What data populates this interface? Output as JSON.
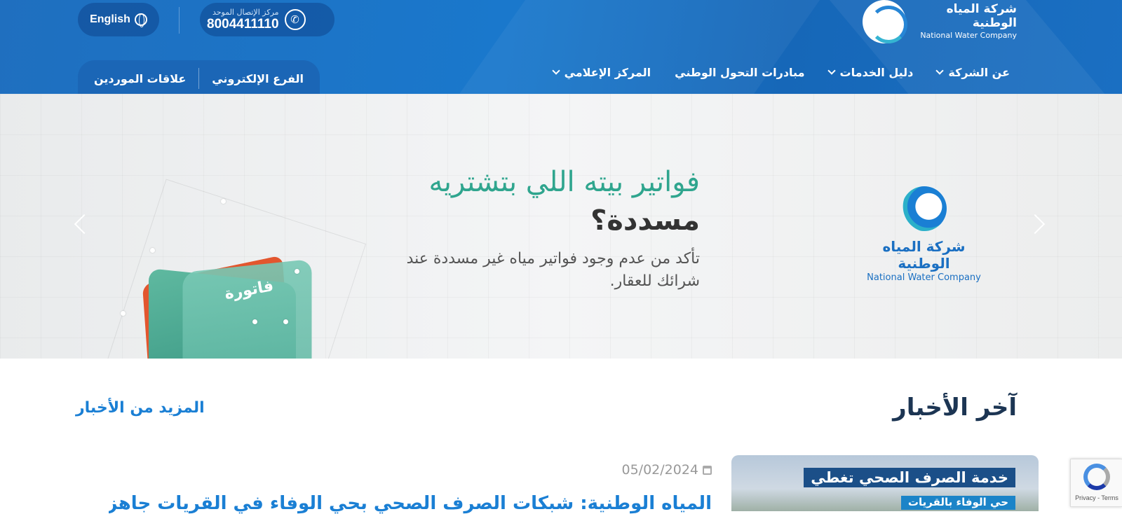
{
  "header": {
    "logo": {
      "name_ar": "شركة المياه الوطنية",
      "name_en": "National Water Company"
    },
    "contact": {
      "label": "مركز الإتصال الموحد",
      "number": "8004411110",
      "icon": "phone-icon"
    },
    "language": {
      "label": "English",
      "icon": "globe-icon"
    },
    "nav": [
      {
        "label": "عن الشركة",
        "has_dropdown": true
      },
      {
        "label": "دليل الخدمات",
        "has_dropdown": true
      },
      {
        "label": "مبادرات التحول الوطني",
        "has_dropdown": false
      },
      {
        "label": "المركز الإعلامي",
        "has_dropdown": true
      }
    ],
    "portal_links": [
      "الفرع الإلكتروني",
      "علاقات الموردين"
    ]
  },
  "hero": {
    "title_line1": "فواتير بيته اللي بتشتريه",
    "title_line2": "مسددة؟",
    "description": "تأكد من عدم وجود فواتير مياه غير مسددة عند شرائك للعقار.",
    "logo_ar": "شركة المياه الوطنية",
    "logo_en": "National Water Company",
    "illustration_label": "فاتورة",
    "illustration_mark": "?"
  },
  "news": {
    "heading": "آخر الأخبار",
    "more_link": "المزيد من الأخبار",
    "items": [
      {
        "date": "05/02/2024",
        "title": "المياه الوطنية: شبكات الصرف الصحي بحي الوفاء في القريات جاهزة لطلب الإتصال",
        "image_title": "خدمة الصرف الصحي تغطي",
        "image_subtitle": "حي الوفاء بالقريات"
      }
    ]
  },
  "recaptcha": {
    "text": "Privacy - Terms"
  },
  "colors": {
    "header_blue": "#1a78cc",
    "accent_green": "#2fa58e",
    "link_blue": "#1a7fd4",
    "heading_dark": "#1c3553"
  }
}
